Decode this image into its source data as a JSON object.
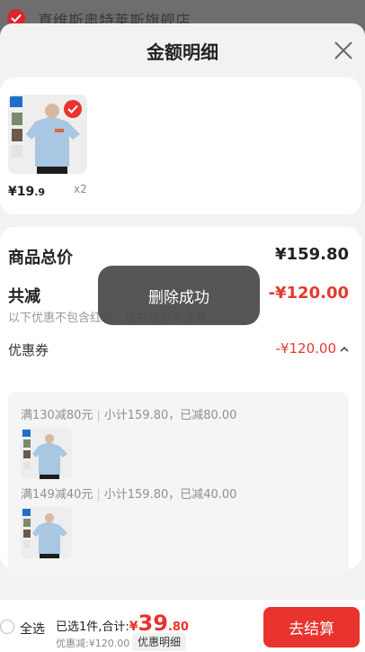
{
  "store": {
    "name": "真维斯奥特莱斯旗舰店"
  },
  "sheet": {
    "title": "金额明细",
    "close_icon": "close-icon"
  },
  "product": {
    "price_symbol": "¥",
    "price_int": "19",
    "price_dec": ".9",
    "quantity": "x2"
  },
  "summary": {
    "total_label": "商品总价",
    "total_value": "¥159.80",
    "reduce_label": "共减",
    "reduce_value": "-¥120.00",
    "reduce_note": "以下优惠不包含红包，请在结算页查看",
    "coupon_label": "优惠券",
    "coupon_value": "-¥120.00"
  },
  "coupons": [
    {
      "rule": "满130减80元",
      "detail": "小计159.80，已减80.00"
    },
    {
      "rule": "满149减40元",
      "detail": "小计159.80，已减40.00"
    }
  ],
  "toast": {
    "message": "删除成功"
  },
  "footer": {
    "select_all": "全选",
    "selected_text": "已选1件,合计:",
    "currency": "¥",
    "amount_int": "39",
    "amount_dec": ".80",
    "discount_text": "优惠减:¥120.00",
    "detail_tag": "优惠明细",
    "checkout": "去结算"
  },
  "colors": {
    "accent": "#e8332f",
    "text": "#222222",
    "muted": "#8a8a8a"
  }
}
